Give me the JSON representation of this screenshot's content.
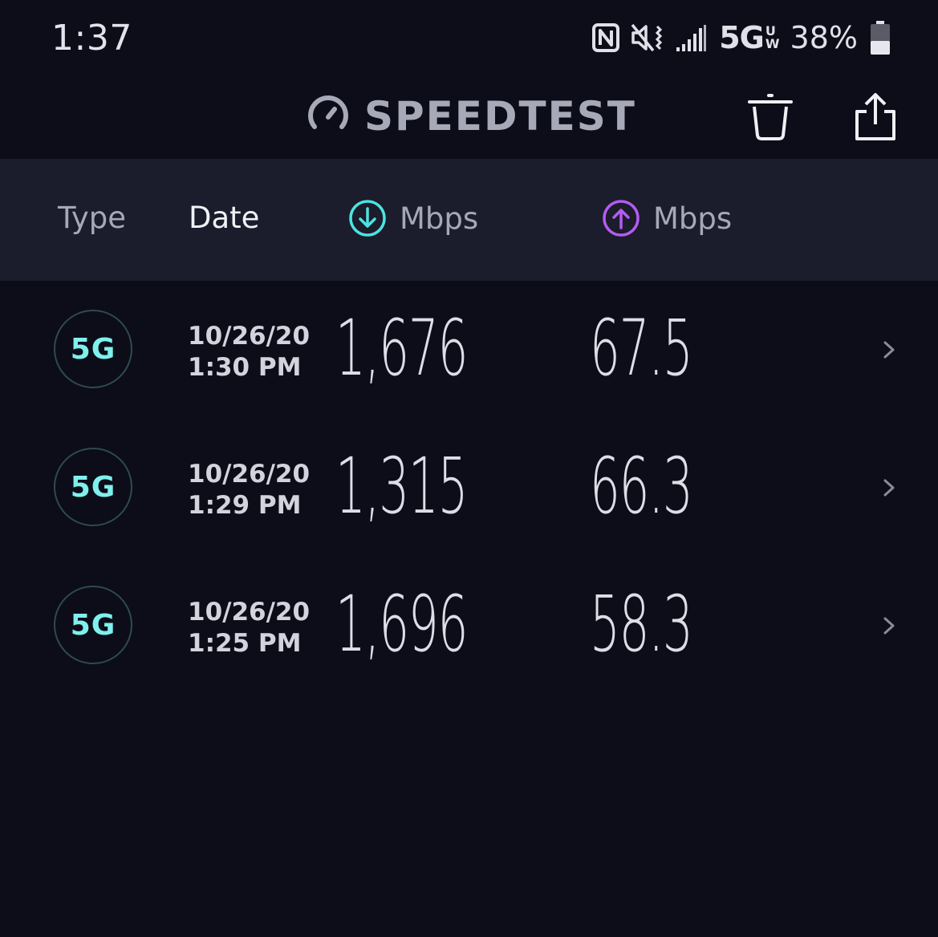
{
  "status_bar": {
    "time": "1:37",
    "network": "5G",
    "network_suffix_top": "U",
    "network_suffix_bottom": "W",
    "battery": "38%",
    "icons": [
      "nfc-icon",
      "vibrate-icon",
      "signal-icon",
      "battery-icon"
    ]
  },
  "app_bar": {
    "title": "SPEEDTEST",
    "icons": [
      "speedometer-icon",
      "trash-icon",
      "share-icon"
    ]
  },
  "header": {
    "type": "Type",
    "date": "Date",
    "download_unit": "Mbps",
    "upload_unit": "Mbps",
    "colors": {
      "download": "#4de3e0",
      "upload": "#b45cf0"
    }
  },
  "results": [
    {
      "type": "5G",
      "date": "10/26/20",
      "time": "1:30 PM",
      "download": "1,676",
      "upload": "67.5"
    },
    {
      "type": "5G",
      "date": "10/26/20",
      "time": "1:29 PM",
      "download": "1,315",
      "upload": "66.3"
    },
    {
      "type": "5G",
      "date": "10/26/20",
      "time": "1:25 PM",
      "download": "1,696",
      "upload": "58.3"
    }
  ],
  "theme": {
    "background": "#0c0d18",
    "header_background": "#1b1c2c",
    "accent": "#7ff0ee"
  }
}
